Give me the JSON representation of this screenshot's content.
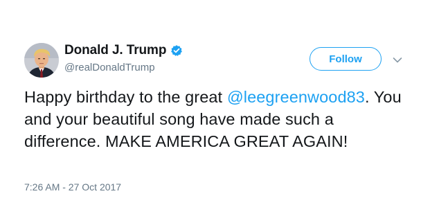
{
  "author": {
    "name": "Donald J. Trump",
    "handle": "@realDonaldTrump",
    "verified": true
  },
  "follow_button": {
    "label": "Follow"
  },
  "more_menu": {
    "icon": "chevron-down-icon"
  },
  "tweet": {
    "text_before_mention": "Happy birthday to the great ",
    "mention": "@leegreenwood83",
    "text_after_mention": ". You and your beautiful song have made such a difference. MAKE AMERICA GREAT AGAIN!",
    "timestamp": "7:26 AM - 27 Oct 2017"
  },
  "colors": {
    "accent": "#1da1f2",
    "text_primary": "#14171a",
    "text_secondary": "#657786"
  }
}
